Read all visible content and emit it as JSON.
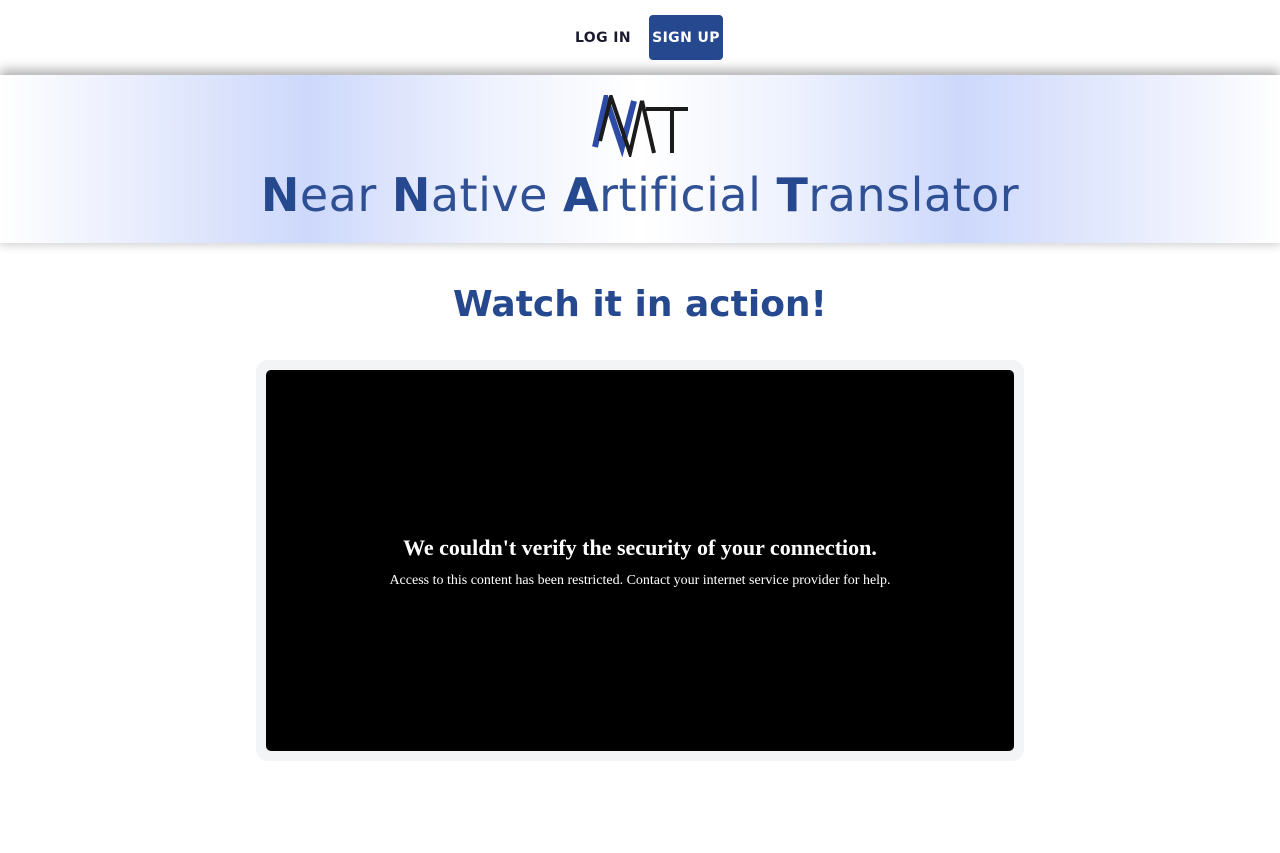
{
  "header": {
    "login_label": "LOG IN",
    "signup_label": "SIGN UP"
  },
  "banner": {
    "logo_icon": "nat-logo-icon",
    "title_parts": [
      {
        "cap": "N",
        "rest": "ear "
      },
      {
        "cap": "N",
        "rest": "ative "
      },
      {
        "cap": "A",
        "rest": "rtificial "
      },
      {
        "cap": "T",
        "rest": "ranslator"
      }
    ]
  },
  "main": {
    "heading": "Watch it in action!",
    "video": {
      "error_title": "We couldn't verify the security of your connection.",
      "error_text": "Access to this content has been restricted. Contact your internet service provider for help."
    }
  },
  "colors": {
    "brand_blue": "#26488f",
    "logo_blue": "#2c4aa6",
    "logo_dark": "#1b1b1b",
    "video_bg": "#000000"
  }
}
